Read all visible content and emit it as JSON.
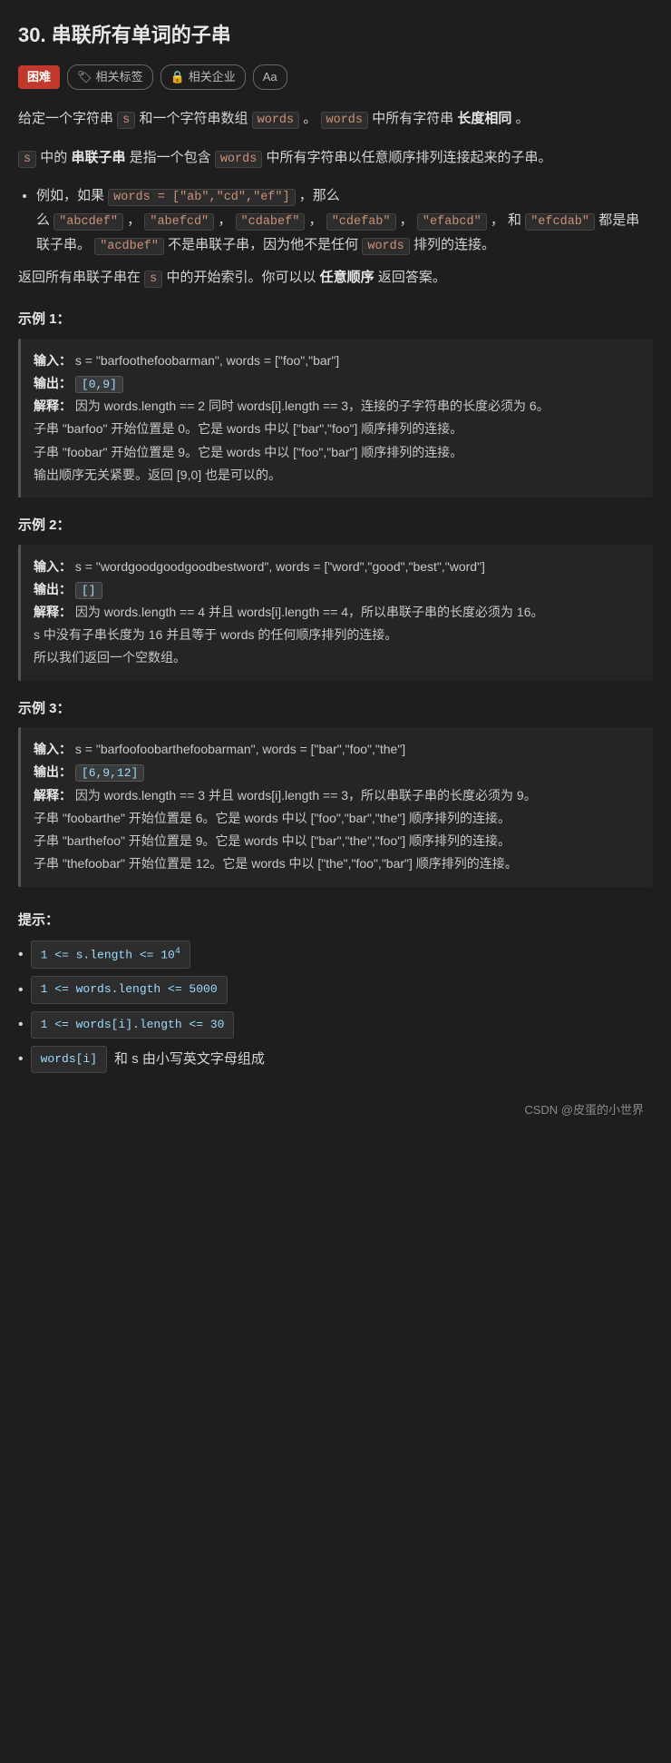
{
  "title": "30. 串联所有单词的子串",
  "tags": {
    "difficulty": "困难",
    "related_tags": "相关标签",
    "related_company": "相关企业",
    "font_label": "Aa"
  },
  "description": {
    "intro": "给定一个字符串",
    "s_var": "s",
    "and_text": "和一个字符串数组",
    "words_var": "words",
    "sentence1": "。",
    "words2": "words",
    "sentence2": "中所有字符串",
    "bold1": "长度相同",
    "sentence3": "。",
    "para2_start": "s",
    "para2_mid": "中的",
    "bold2": "串联子串",
    "para2_rest": "是指一个包含",
    "words3": "words",
    "para2_end": "中所有字符串以任意顺序排列连接起来的子串。",
    "example_intro": "例如，如果",
    "words_eq": "words = [\"ab\",\"cd\",\"ef\"]",
    "then": "，那么",
    "valid_examples": "\"abcdef\"，\"abefcd\"，\"cdabef\"，\"cdefab\"，\"efabcd\"，和 \"efcdab\"",
    "are_valid": "都是串联子串。",
    "invalid": "\"acdbef\"",
    "not_valid": "不是串联子串，因为他不是任何",
    "words_ref": "words",
    "not_concat": "排列的连接。",
    "return_text": "返回所有串联子串在",
    "s_ref2": "s",
    "return_rest": "中的开始索引。你可以以",
    "bold3": "任意顺序",
    "return_end": "返回答案。"
  },
  "examples": [
    {
      "title": "示例 1：",
      "input_label": "输入：",
      "input_value": "s = \"barfoothefoobarman\", words = [\"foo\",\"bar\"]",
      "output_label": "输出：",
      "output_value": "[0,9]",
      "explain_label": "解释：",
      "explain": "因为 words.length == 2 同时 words[i].length == 3，连接的子字符串的长度必须为 6。\n子串 \"barfoo\" 开始位置是 0。它是 words 中以 [\"bar\",\"foo\"] 顺序排列的连接。\n子串 \"foobar\" 开始位置是 9。它是 words 中以 [\"foo\",\"bar\"] 顺序排列的连接。\n输出顺序无关紧要。返回 [9,0] 也是可以的。"
    },
    {
      "title": "示例 2：",
      "input_label": "输入：",
      "input_value": "s = \"wordgoodgoodgoodbestword\", words = [\"word\",\"good\",\"best\",\"word\"]",
      "output_label": "输出：",
      "output_value": "[]",
      "explain_label": "解释：",
      "explain": "因为 words.length == 4 并且 words[i].length == 4，所以串联子串的长度必须为 16。\ns 中没有子串长度为 16 并且等于 words 的任何顺序排列的连接。\n所以我们返回一个空数组。"
    },
    {
      "title": "示例 3：",
      "input_label": "输入：",
      "input_value": "s = \"barfoofoobarthefoobarman\", words = [\"bar\",\"foo\",\"the\"]",
      "output_label": "输出：",
      "output_value": "[6,9,12]",
      "explain_label": "解释：",
      "explain": "因为 words.length == 3 并且 words[i].length == 3，所以串联子串的长度必须为 9。\n子串 \"foobarthe\" 开始位置是 6。它是 words 中以 [\"foo\",\"bar\",\"the\"] 顺序排列的连接。\n子串 \"barthefoo\" 开始位置是 9。它是 words 中以 [\"bar\",\"the\",\"foo\"] 顺序排列的连接。\n子串 \"thefoobar\" 开始位置是 12。它是 words 中以 [\"the\",\"foo\",\"bar\"] 顺序排列的连接。"
    }
  ],
  "hints": {
    "title": "提示：",
    "items": [
      {
        "code": "1 <= s.length <= 10",
        "sup": "4",
        "text": ""
      },
      {
        "code": "1 <= words.length <= 5000",
        "text": ""
      },
      {
        "code": "1 <= words[i].length <= 30",
        "text": ""
      },
      {
        "code": "words[i]",
        "text": "和 s 由小写英文字母组成"
      }
    ]
  },
  "footer": {
    "text": "CSDN @皮蛋的小世界"
  }
}
